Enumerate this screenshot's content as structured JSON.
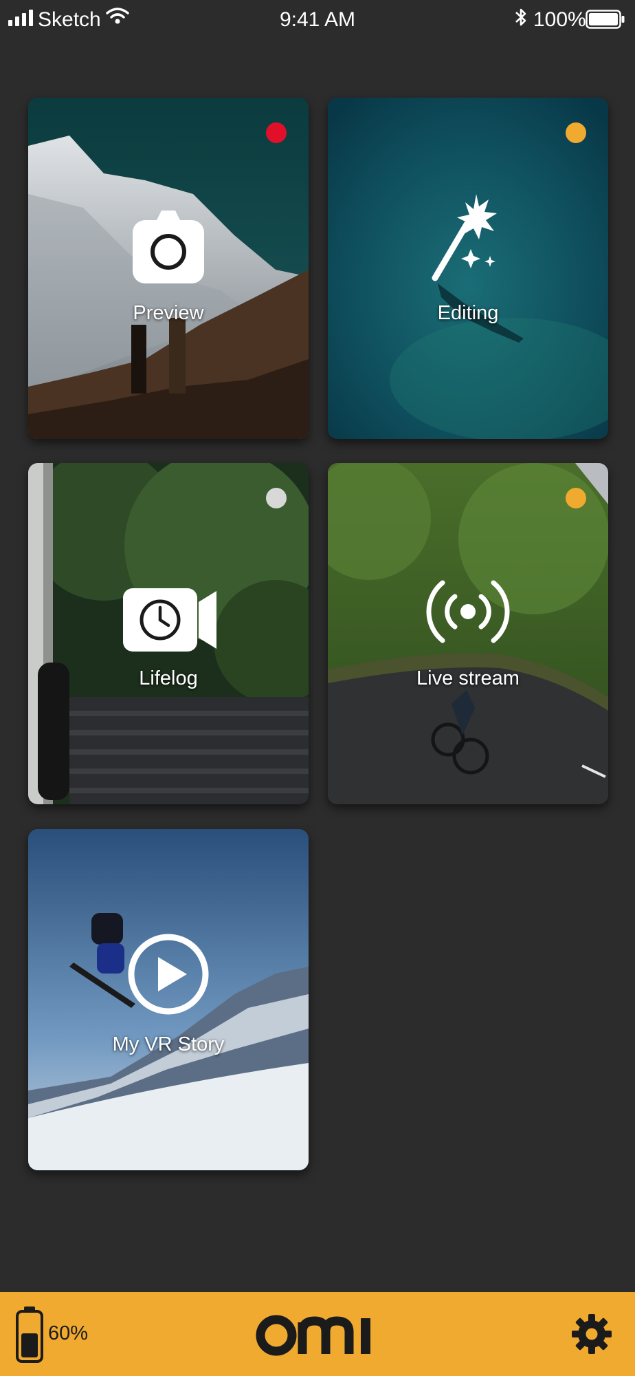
{
  "status_bar": {
    "carrier": "Sketch",
    "time": "9:41 AM",
    "battery": "100%"
  },
  "tiles": [
    {
      "label": "Preview",
      "icon": "camera-icon",
      "status_color": "#e0102a"
    },
    {
      "label": "Editing",
      "icon": "magic-wand-icon",
      "status_color": "#f0aa2f"
    },
    {
      "label": "Lifelog",
      "icon": "timelapse-video-icon",
      "status_color": "#d8d8d8"
    },
    {
      "label": "Live stream",
      "icon": "broadcast-icon",
      "status_color": "#f0aa2f"
    },
    {
      "label": "My VR Story",
      "icon": "play-icon",
      "status_color": ""
    }
  ],
  "bottom_bar": {
    "battery_level": "60%",
    "logo": "omi",
    "settings_icon": "gear-icon",
    "accent_color": "#f0aa2f"
  }
}
